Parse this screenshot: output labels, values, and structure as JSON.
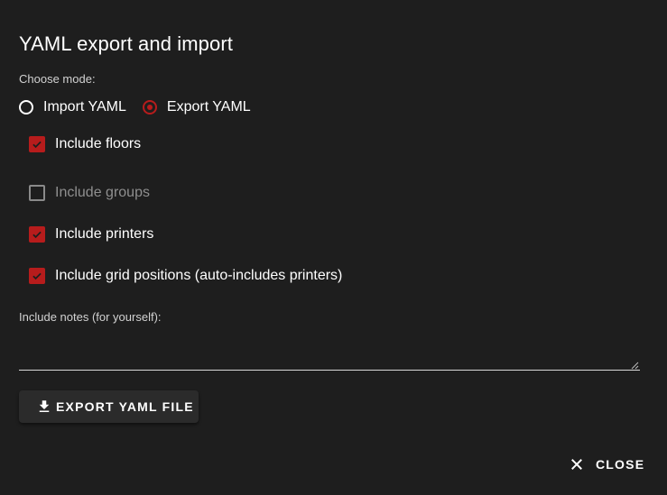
{
  "dialog": {
    "title": "YAML export and import",
    "mode_label": "Choose mode:",
    "modes": [
      {
        "label": "Import YAML",
        "selected": false
      },
      {
        "label": "Export YAML",
        "selected": true
      }
    ],
    "options": [
      {
        "label": "Include floors",
        "checked": true,
        "disabled": false
      },
      {
        "label": "Include groups",
        "checked": false,
        "disabled": true
      },
      {
        "label": "Include printers",
        "checked": true,
        "disabled": false
      },
      {
        "label": "Include grid positions (auto-includes printers)",
        "checked": true,
        "disabled": false
      }
    ],
    "notes_label": "Include notes (for yourself):",
    "notes_value": "",
    "export_button_label": "EXPORT YAML FILE",
    "export_button_icon": "download-icon",
    "close_button_label": "CLOSE",
    "close_button_icon": "close-icon"
  },
  "colors": {
    "background": "#1e1e1e",
    "accent": "#b71c1c",
    "button_bg": "#2b2b2b"
  }
}
